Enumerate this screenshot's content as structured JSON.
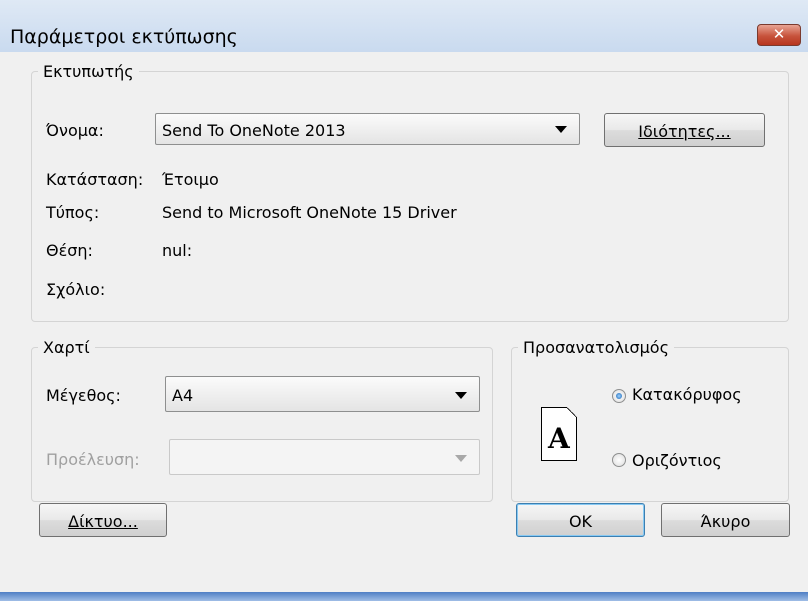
{
  "window": {
    "title": "Παράμετροι εκτύπωσης"
  },
  "icons": {
    "close": "✕",
    "close_name": "close-icon",
    "page": "A"
  },
  "printer": {
    "group_label": "Εκτυπωτής",
    "name_label": "Όνομα:",
    "name_value": "Send To OneNote 2013",
    "properties_button": "Ιδιότητες...",
    "status_label": "Κατάσταση:",
    "status_value": "Έτοιμο",
    "type_label": "Τύπος:",
    "type_value": "Send to Microsoft OneNote 15 Driver",
    "where_label": "Θέση:",
    "where_value": "nul:",
    "comment_label": "Σχόλιο:"
  },
  "paper": {
    "group_label": "Χαρτί",
    "size_label": "Μέγεθος:",
    "size_value": "A4",
    "source_label": "Προέλευση:",
    "source_value": ""
  },
  "orientation": {
    "group_label": "Προσανατολισμός",
    "options": [
      {
        "label": "Κατακόρυφος",
        "selected": true
      },
      {
        "label": "Οριζόντιος",
        "selected": false
      }
    ]
  },
  "buttons": {
    "network": "Δίκτυο...",
    "ok": "OK",
    "cancel": "Άκυρο"
  },
  "colors": {
    "title_bar": "#c9daef",
    "close_button": "#c7533c",
    "default_button_border": "#3c7fb1"
  }
}
